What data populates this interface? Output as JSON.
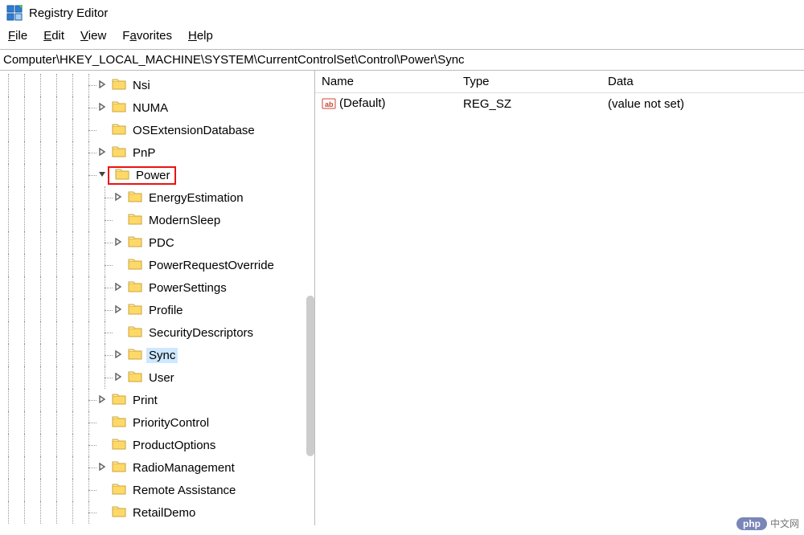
{
  "window": {
    "title": "Registry Editor"
  },
  "menu": {
    "file": "File",
    "edit": "Edit",
    "view": "View",
    "favorites": "Favorites",
    "help": "Help"
  },
  "path": "Computer\\HKEY_LOCAL_MACHINE\\SYSTEM\\CurrentControlSet\\Control\\Power\\Sync",
  "tree": {
    "items": [
      {
        "label": "Nsi",
        "depth": 4,
        "expander": ">"
      },
      {
        "label": "NUMA",
        "depth": 4,
        "expander": ">"
      },
      {
        "label": "OSExtensionDatabase",
        "depth": 4,
        "expander": ""
      },
      {
        "label": "PnP",
        "depth": 4,
        "expander": ">"
      },
      {
        "label": "Power",
        "depth": 4,
        "expander": "v",
        "highlight": true
      },
      {
        "label": "EnergyEstimation",
        "depth": 5,
        "expander": ">"
      },
      {
        "label": "ModernSleep",
        "depth": 5,
        "expander": ""
      },
      {
        "label": "PDC",
        "depth": 5,
        "expander": ">"
      },
      {
        "label": "PowerRequestOverride",
        "depth": 5,
        "expander": ""
      },
      {
        "label": "PowerSettings",
        "depth": 5,
        "expander": ">"
      },
      {
        "label": "Profile",
        "depth": 5,
        "expander": ">"
      },
      {
        "label": "SecurityDescriptors",
        "depth": 5,
        "expander": ""
      },
      {
        "label": "Sync",
        "depth": 5,
        "expander": ">",
        "selected": true
      },
      {
        "label": "User",
        "depth": 5,
        "expander": ">"
      },
      {
        "label": "Print",
        "depth": 4,
        "expander": ">"
      },
      {
        "label": "PriorityControl",
        "depth": 4,
        "expander": ""
      },
      {
        "label": "ProductOptions",
        "depth": 4,
        "expander": ""
      },
      {
        "label": "RadioManagement",
        "depth": 4,
        "expander": ">"
      },
      {
        "label": "Remote Assistance",
        "depth": 4,
        "expander": ""
      },
      {
        "label": "RetailDemo",
        "depth": 4,
        "expander": ""
      }
    ]
  },
  "list": {
    "columns": {
      "name": "Name",
      "type": "Type",
      "data": "Data"
    },
    "rows": [
      {
        "name": "(Default)",
        "type": "REG_SZ",
        "data": "(value not set)"
      }
    ]
  },
  "watermark": {
    "badge": "php",
    "text": "中文网"
  }
}
